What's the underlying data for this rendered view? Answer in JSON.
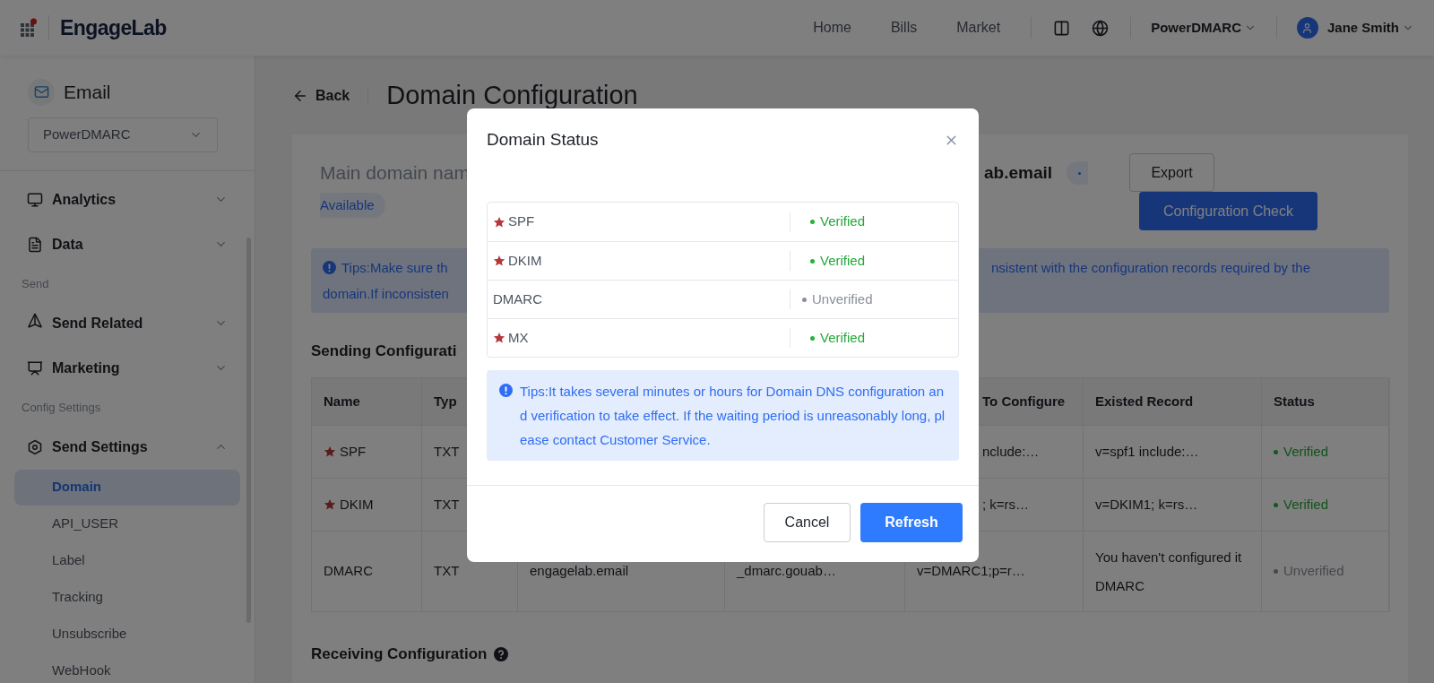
{
  "header": {
    "logo": "EngageLab",
    "nav": [
      {
        "label": "Home"
      },
      {
        "label": "Bills"
      },
      {
        "label": "Market"
      }
    ],
    "workspace": "PowerDMARC",
    "user": "Jane Smith"
  },
  "sidebar": {
    "product": "Email",
    "account": "PowerDMARC",
    "menu": [
      {
        "kind": "item",
        "label": "Analytics",
        "expanded": false
      },
      {
        "kind": "item",
        "label": "Data",
        "expanded": false
      },
      {
        "kind": "section",
        "label": "Send"
      },
      {
        "kind": "item",
        "label": "Send Related",
        "expanded": false
      },
      {
        "kind": "item",
        "label": "Marketing",
        "expanded": false
      },
      {
        "kind": "section",
        "label": "Config Settings"
      },
      {
        "kind": "item",
        "label": "Send Settings",
        "expanded": true,
        "children": [
          {
            "label": "Domain",
            "selected": true
          },
          {
            "label": "API_USER",
            "selected": false
          },
          {
            "label": "Label",
            "selected": false
          },
          {
            "label": "Tracking",
            "selected": false
          },
          {
            "label": "Unsubscribe",
            "selected": false
          },
          {
            "label": "WebHook",
            "selected": false
          }
        ]
      }
    ]
  },
  "page": {
    "back": "Back",
    "title": "Domain Configuration",
    "domain_label": "Main domain nam",
    "domain_value": "ab.email",
    "domain_badge": "Available",
    "export": "Export",
    "check": "Configuration Check",
    "tips": {
      "line_1_left": "Tips:Make sure th",
      "line_1_right": "nsistent with the configuration records required by the",
      "line_2": "domain.If inconsisten"
    },
    "sending_title": "Sending Configurati",
    "table": {
      "header": {
        "name": "Name",
        "type": "Typ",
        "to_configure": "To Configure",
        "existed_record": "Existed Record",
        "status": "Status"
      },
      "rows": [
        {
          "name": {
            "text": "SPF",
            "required": true
          },
          "type": "TXT",
          "to_configure": "nclude:…",
          "existed_record": "v=spf1 include:…",
          "status": {
            "text": "Verified",
            "verified": true
          }
        },
        {
          "name": {
            "text": "DKIM",
            "required": true
          },
          "type": "TXT",
          "to_configure": "; k=rs…",
          "existed_record": "v=DKIM1; k=rs…",
          "status": {
            "text": "Verified",
            "verified": true
          }
        },
        {
          "name": {
            "text": "DMARC",
            "required": false
          },
          "type": "TXT",
          "column_3": "engagelab.email",
          "column_4": "_dmarc.gouab…",
          "to_configure": "v=DMARC1;p=r…",
          "existed_record": "You haven't configured it DMARC",
          "status": {
            "text": "Unverified",
            "verified": false
          }
        }
      ]
    },
    "receiving_title": "Receiving Configuration"
  },
  "modal": {
    "title": "Domain Status",
    "rows": [
      {
        "name": "SPF",
        "required": true,
        "status": "Verified",
        "verified": true
      },
      {
        "name": "DKIM",
        "required": true,
        "status": "Verified",
        "verified": true
      },
      {
        "name": "DMARC",
        "required": false,
        "status": "Unverified",
        "verified": false
      },
      {
        "name": "MX",
        "required": true,
        "status": "Verified",
        "verified": true
      }
    ],
    "tip": "Tips:It takes several minutes or hours for Domain DNS configuration and verification to take effect. If the waiting period is unreasonably long, please contact Customer Service.",
    "cancel": "Cancel",
    "refresh": "Refresh"
  }
}
